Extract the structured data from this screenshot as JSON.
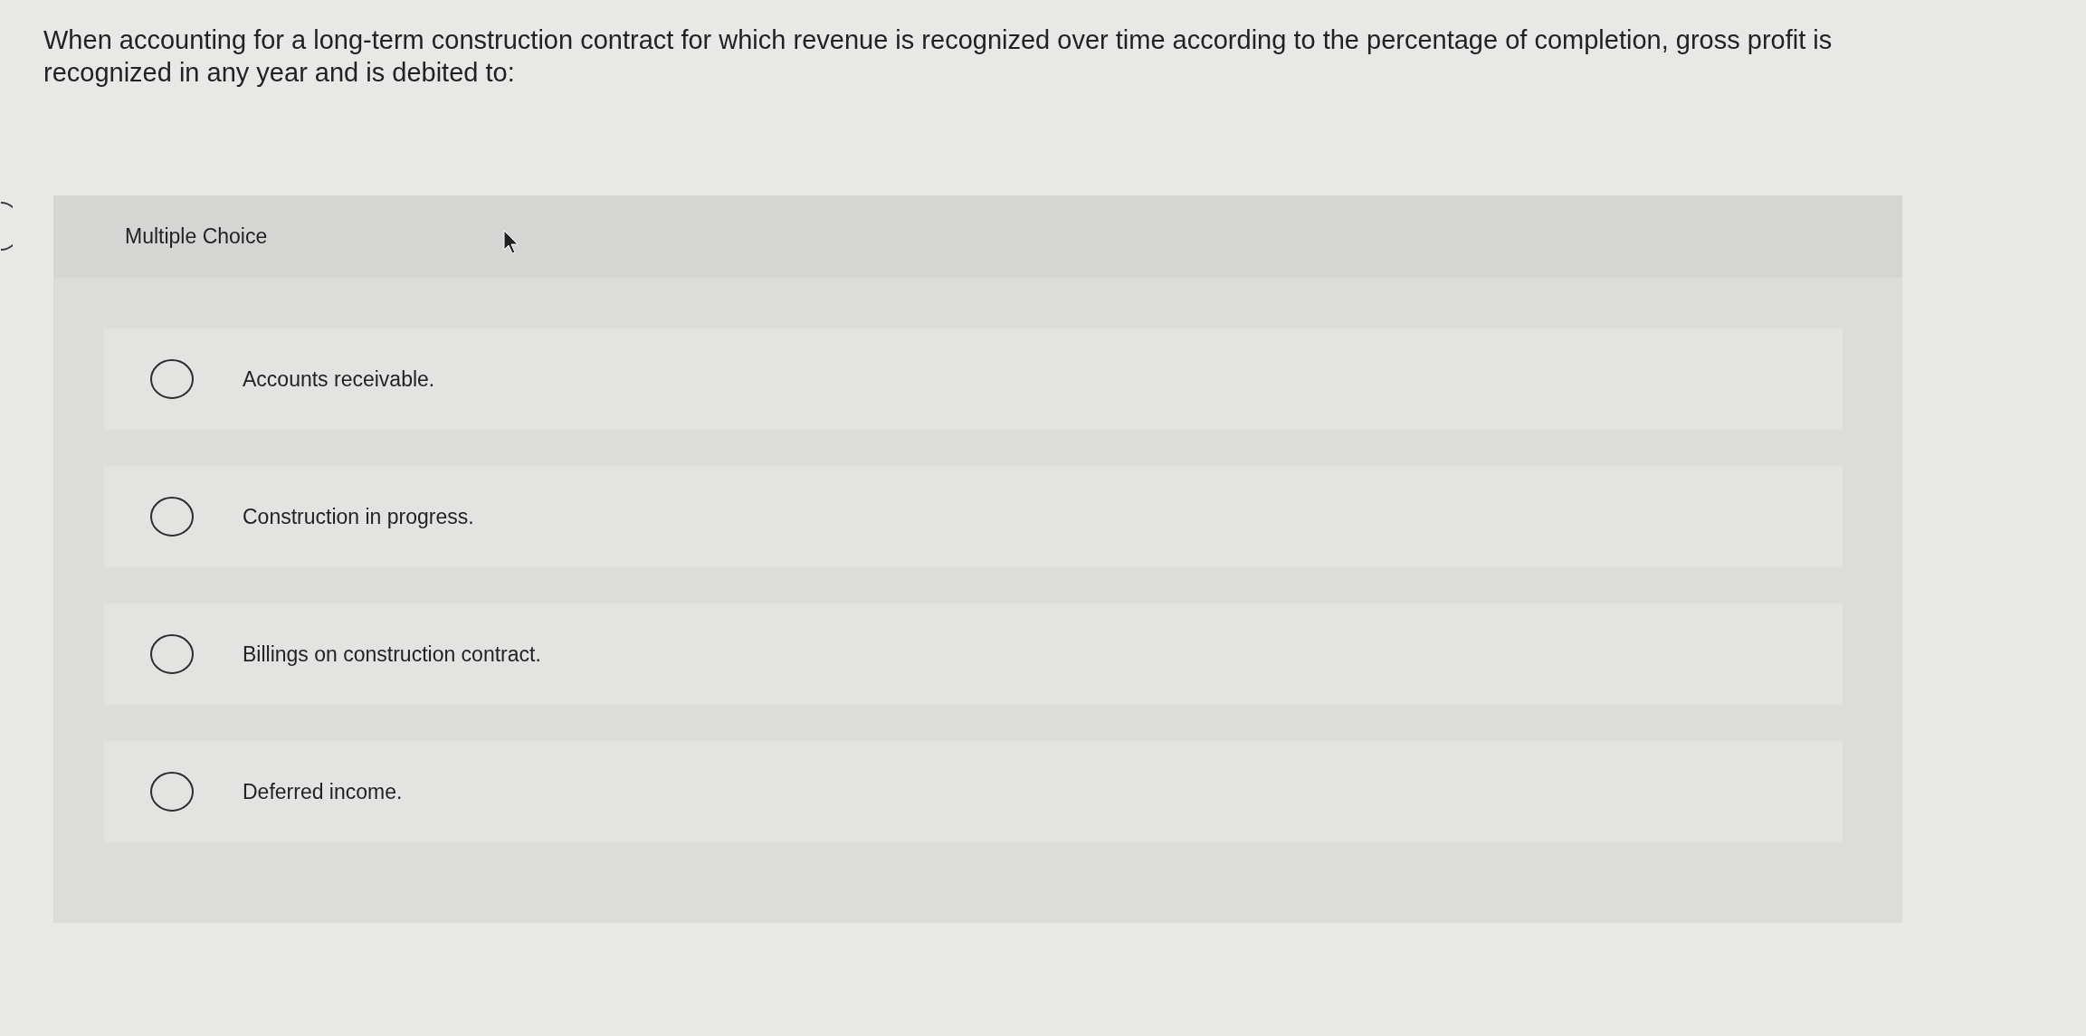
{
  "question": "When accounting for a long-term construction contract for which revenue is recognized over time according to the percentage of completion, gross profit is recognized in any year and is debited to:",
  "multiple_choice": {
    "heading": "Multiple Choice",
    "options": [
      {
        "label": "Accounts receivable.",
        "selected": false
      },
      {
        "label": "Construction in progress.",
        "selected": false
      },
      {
        "label": "Billings on construction contract.",
        "selected": false
      },
      {
        "label": "Deferred income.",
        "selected": false
      }
    ]
  }
}
